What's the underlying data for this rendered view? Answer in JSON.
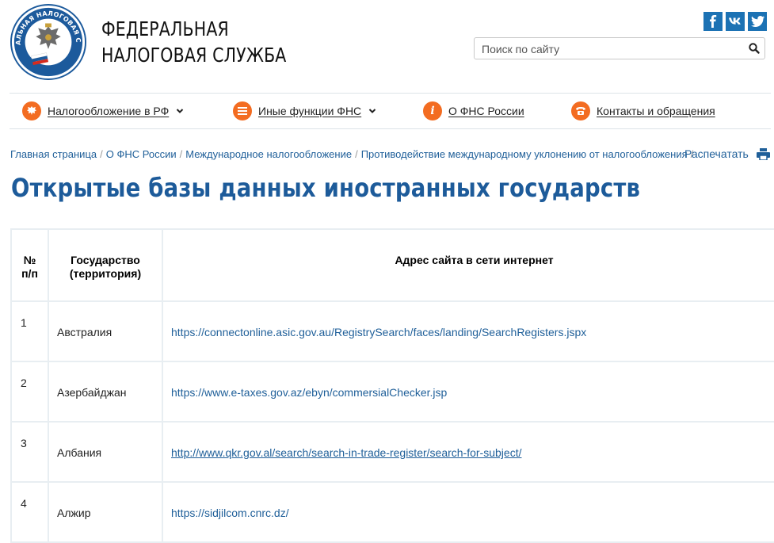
{
  "header": {
    "logo_text": "ФЕДЕРАЛЬНАЯ НАЛОГОВАЯ СЛУЖБА",
    "title_line1": "ФЕДЕРАЛЬНАЯ",
    "title_line2": "НАЛОГОВАЯ СЛУЖБА",
    "social": [
      {
        "name": "facebook",
        "glyph": "f"
      },
      {
        "name": "vkontakte",
        "glyph": "вк"
      },
      {
        "name": "twitter",
        "glyph": "t"
      }
    ],
    "search_placeholder": "Поиск по сайту"
  },
  "nav": {
    "items": [
      {
        "label": "Налогообложение в РФ",
        "icon": "emblem-icon",
        "has_dropdown": true
      },
      {
        "label": "Иные функции ФНС",
        "icon": "menu-icon",
        "has_dropdown": true
      },
      {
        "label": "О ФНС России",
        "icon": "info-icon",
        "has_dropdown": false
      },
      {
        "label": "Контакты и обращения",
        "icon": "phone-icon",
        "has_dropdown": false
      }
    ]
  },
  "breadcrumbs": [
    "Главная страница",
    "О ФНС России",
    "Международное налогообложение",
    "Противодействие международному уклонению от налогообложения"
  ],
  "print_label": "Распечатать",
  "page_title": "Открытые базы данных иностранных государств",
  "table": {
    "headers": {
      "num": "№ п/п",
      "country": "Государство (территория)",
      "url": "Адрес сайта в сети интернет"
    },
    "rows": [
      {
        "num": "1",
        "country": "Австралия",
        "url": "https://connectonline.asic.gov.au/RegistrySearch/faces/landing/SearchRegisters.jspx",
        "underlined": false
      },
      {
        "num": "2",
        "country": "Азербайджан",
        "url": "https://www.e-taxes.gov.az/ebyn/commersialChecker.jsp",
        "underlined": false
      },
      {
        "num": "3",
        "country": "Албания",
        "url": "http://www.qkr.gov.al/search/search-in-trade-register/search-for-subject/",
        "underlined": true
      },
      {
        "num": "4",
        "country": "Алжир",
        "url": "https://sidjilcom.cnrc.dz/",
        "underlined": false
      }
    ]
  },
  "colors": {
    "accent_blue": "#1d5b9a",
    "link_blue": "#1f5f99",
    "nav_orange": "#f36c21",
    "social_blue": "#1c72b4"
  }
}
